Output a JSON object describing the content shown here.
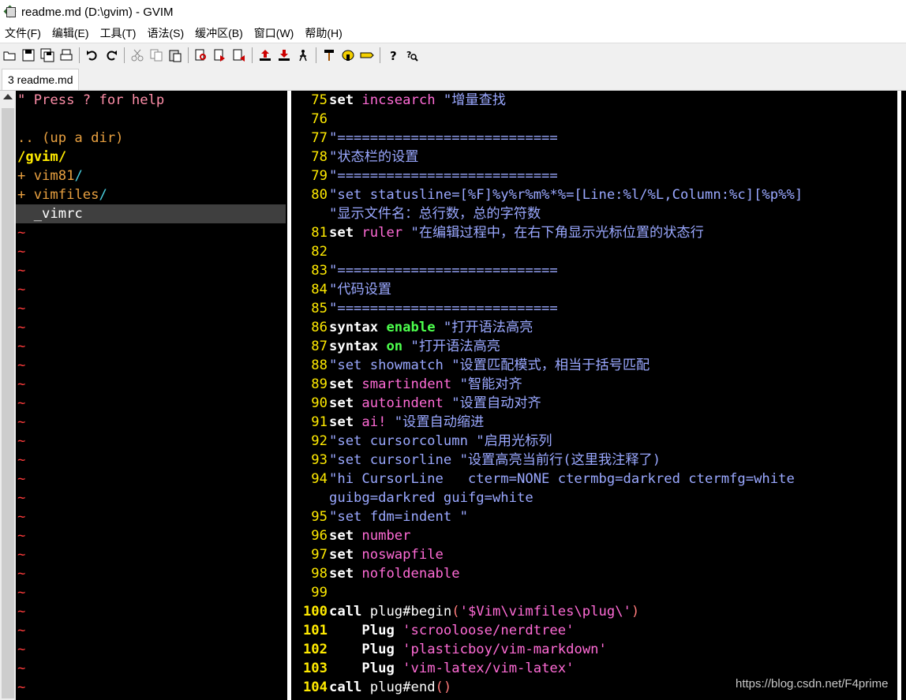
{
  "window": {
    "title": "readme.md (D:\\gvim) - GVIM"
  },
  "menu": [
    "文件(F)",
    "编辑(E)",
    "工具(T)",
    "语法(S)",
    "缓冲区(B)",
    "窗口(W)",
    "帮助(H)"
  ],
  "toolbar_icons": [
    "open-icon",
    "save-icon",
    "save-all-icon",
    "print-icon",
    "undo-icon",
    "redo-icon",
    "cut-icon",
    "copy-icon",
    "paste-icon",
    "find-icon",
    "find-next-icon",
    "find-prev-icon",
    "load-session-icon",
    "save-session-icon",
    "run-script-icon",
    "make-icon",
    "shell-icon",
    "tags-icon",
    "help-icon",
    "find-help-icon"
  ],
  "tab": {
    "label": "3 readme.md"
  },
  "tree": {
    "hint": "\" Press ? for help",
    "updir": ".. (up a dir)",
    "root": "/gvim/",
    "dirs": [
      {
        "plus": "+ ",
        "name": "vim81",
        "slash": "/"
      },
      {
        "plus": "+ ",
        "name": "vimfiles",
        "slash": "/"
      }
    ],
    "file": "  _vimrc",
    "tilde": "~"
  },
  "code": [
    {
      "n": "75",
      "t": [
        [
          "kw",
          "set"
        ],
        [
          "plain",
          " "
        ],
        [
          "opt",
          "incsearch"
        ],
        [
          "cm",
          " \"增量查找"
        ]
      ]
    },
    {
      "n": "76",
      "t": []
    },
    {
      "n": "77",
      "t": [
        [
          "cm",
          "\"==========================="
        ]
      ]
    },
    {
      "n": "78",
      "t": [
        [
          "cm",
          "\"状态栏的设置"
        ]
      ]
    },
    {
      "n": "79",
      "t": [
        [
          "cm",
          "\"==========================="
        ]
      ]
    },
    {
      "n": "80",
      "t": [
        [
          "cm",
          "\"set statusline=[%F]%y%r%m%*%=[Line:%l/%L,Column:%c][%p%%]"
        ]
      ]
    },
    {
      "n": "",
      "t": [
        [
          "cm",
          "\"显示文件名：总行数，总的字符数"
        ]
      ]
    },
    {
      "n": "81",
      "t": [
        [
          "kw",
          "set"
        ],
        [
          "plain",
          " "
        ],
        [
          "opt",
          "ruler"
        ],
        [
          "cm",
          " \"在编辑过程中，在右下角显示光标位置的状态行"
        ]
      ]
    },
    {
      "n": "82",
      "t": []
    },
    {
      "n": "83",
      "t": [
        [
          "cm",
          "\"==========================="
        ]
      ]
    },
    {
      "n": "84",
      "t": [
        [
          "cm",
          "\"代码设置"
        ]
      ]
    },
    {
      "n": "85",
      "t": [
        [
          "cm",
          "\"==========================="
        ]
      ]
    },
    {
      "n": "86",
      "t": [
        [
          "kw",
          "syntax"
        ],
        [
          "plain",
          " "
        ],
        [
          "grn",
          "enable"
        ],
        [
          "cm",
          " \"打开语法高亮"
        ]
      ]
    },
    {
      "n": "87",
      "t": [
        [
          "kw",
          "syntax"
        ],
        [
          "plain",
          " "
        ],
        [
          "grn",
          "on"
        ],
        [
          "cm",
          " \"打开语法高亮"
        ]
      ]
    },
    {
      "n": "88",
      "t": [
        [
          "cm",
          "\"set showmatch \"设置匹配模式，相当于括号匹配"
        ]
      ]
    },
    {
      "n": "89",
      "t": [
        [
          "kw",
          "set"
        ],
        [
          "plain",
          " "
        ],
        [
          "opt",
          "smartindent"
        ],
        [
          "cm",
          " \"智能对齐"
        ]
      ]
    },
    {
      "n": "90",
      "t": [
        [
          "kw",
          "set"
        ],
        [
          "plain",
          " "
        ],
        [
          "opt",
          "autoindent"
        ],
        [
          "cm",
          " \"设置自动对齐"
        ]
      ]
    },
    {
      "n": "91",
      "t": [
        [
          "kw",
          "set"
        ],
        [
          "plain",
          " "
        ],
        [
          "opt",
          "ai!"
        ],
        [
          "cm",
          " \"设置自动缩进"
        ]
      ]
    },
    {
      "n": "92",
      "t": [
        [
          "cm",
          "\"set cursorcolumn \"启用光标列"
        ]
      ]
    },
    {
      "n": "93",
      "t": [
        [
          "cm",
          "\"set cursorline \"设置高亮当前行(这里我注释了)"
        ]
      ]
    },
    {
      "n": "94",
      "t": [
        [
          "cm",
          "\"hi CursorLine   cterm=NONE ctermbg=darkred ctermfg=white"
        ]
      ]
    },
    {
      "n": "",
      "t": [
        [
          "cm",
          "guibg=darkred guifg=white"
        ]
      ]
    },
    {
      "n": "95",
      "t": [
        [
          "cm",
          "\"set fdm=indent \""
        ]
      ]
    },
    {
      "n": "96",
      "t": [
        [
          "kw",
          "set"
        ],
        [
          "plain",
          " "
        ],
        [
          "opt",
          "number"
        ]
      ]
    },
    {
      "n": "97",
      "t": [
        [
          "kw",
          "set"
        ],
        [
          "plain",
          " "
        ],
        [
          "opt",
          "noswapfile"
        ]
      ]
    },
    {
      "n": "98",
      "t": [
        [
          "kw",
          "set"
        ],
        [
          "plain",
          " "
        ],
        [
          "opt",
          "nofoldenable"
        ]
      ]
    },
    {
      "n": "99",
      "t": []
    },
    {
      "n": "100",
      "t": [
        [
          "kw",
          "call"
        ],
        [
          "plain",
          " plug#begin"
        ],
        [
          "paren",
          "("
        ],
        [
          "str",
          "'$Vim\\vimfiles\\plug\\'"
        ],
        [
          "paren",
          ")"
        ]
      ]
    },
    {
      "n": "101",
      "t": [
        [
          "plain",
          "    "
        ],
        [
          "kw",
          "Plug"
        ],
        [
          "plain",
          " "
        ],
        [
          "str",
          "'scrooloose/nerdtree'"
        ]
      ]
    },
    {
      "n": "102",
      "t": [
        [
          "plain",
          "    "
        ],
        [
          "kw",
          "Plug"
        ],
        [
          "plain",
          " "
        ],
        [
          "str",
          "'plasticboy/vim-markdown'"
        ]
      ]
    },
    {
      "n": "103",
      "t": [
        [
          "plain",
          "    "
        ],
        [
          "kw",
          "Plug"
        ],
        [
          "plain",
          " "
        ],
        [
          "str",
          "'vim-latex/vim-latex'"
        ]
      ]
    },
    {
      "n": "104",
      "t": [
        [
          "kw",
          "call"
        ],
        [
          "plain",
          " plug#end"
        ],
        [
          "paren",
          "()"
        ]
      ]
    }
  ],
  "watermark": "https://blog.csdn.net/F4prime"
}
